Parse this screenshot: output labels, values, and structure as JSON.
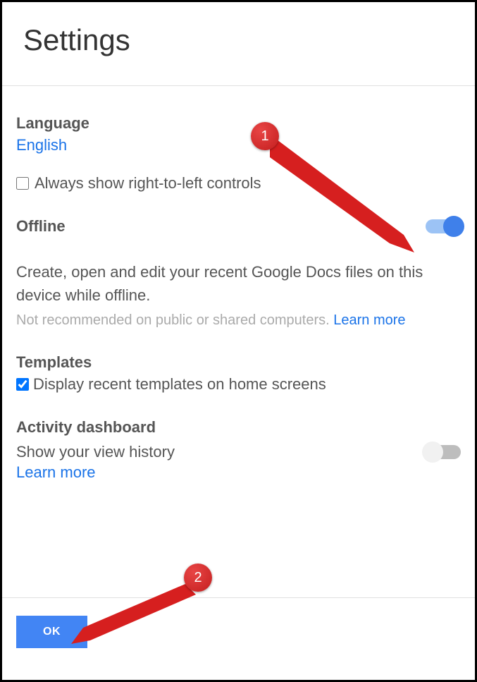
{
  "header": {
    "title": "Settings"
  },
  "language": {
    "label": "Language",
    "value": "English",
    "rtl_checkbox_label": "Always show right-to-left controls"
  },
  "offline": {
    "label": "Offline",
    "description": "Create, open and edit your recent Google Docs files on this device while offline.",
    "warning": "Not recommended on public or shared computers. ",
    "learn_more": "Learn more"
  },
  "templates": {
    "label": "Templates",
    "checkbox_label": "Display recent templates on home screens"
  },
  "activity": {
    "label": "Activity dashboard",
    "subtitle": "Show your view history",
    "learn_more": "Learn more"
  },
  "footer": {
    "ok_label": "OK"
  },
  "annotations": {
    "badge1": "1",
    "badge2": "2"
  }
}
